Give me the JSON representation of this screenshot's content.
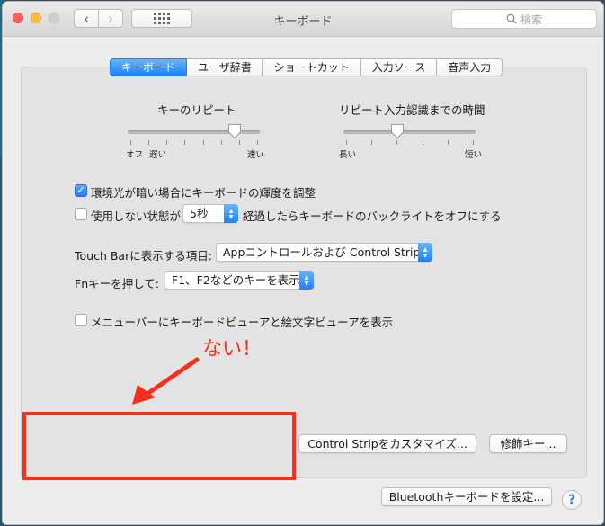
{
  "window": {
    "title": "キーボード",
    "search_placeholder": "検索"
  },
  "tabs": [
    {
      "label": "キーボード",
      "active": true
    },
    {
      "label": "ユーザ辞書",
      "active": false
    },
    {
      "label": "ショートカット",
      "active": false
    },
    {
      "label": "入力ソース",
      "active": false
    },
    {
      "label": "音声入力",
      "active": false
    }
  ],
  "key_repeat": {
    "label": "キーのリピート",
    "left_label": "オフ",
    "left2_label": "遅い",
    "right_label": "速い",
    "value_fraction": 0.82
  },
  "delay_until_repeat": {
    "label": "リピート入力認識までの時間",
    "left_label": "長い",
    "right_label": "短い",
    "value_fraction": 0.4
  },
  "options": {
    "adjust_brightness": {
      "label": "環境光が暗い場合にキーボードの輝度を調整",
      "checked": true
    },
    "backlight_off": {
      "label_before": "使用しない状態が",
      "value": "5秒",
      "label_after": "経過したらキーボードのバックライトをオフにする",
      "checked": false
    },
    "touch_bar": {
      "label": "Touch Barに表示する項目:",
      "value": "Appコントロールおよび Control Strip"
    },
    "fn_key": {
      "label": "Fnキーを押して:",
      "value": "F1、F2などのキーを表示"
    },
    "show_viewers": {
      "label": "メニューバーにキーボードビューアと絵文字ビューアを表示",
      "checked": false
    }
  },
  "buttons": {
    "customize_control_strip": "Control Stripをカスタマイズ...",
    "modifier_keys": "修飾キー...",
    "bluetooth_setup": "Bluetoothキーボードを設定...",
    "help": "?"
  },
  "annotation": {
    "text": "ない！",
    "color": "#f2301c"
  },
  "colors": {
    "accent": "#1a82fb",
    "annotation_red": "#f2301c"
  }
}
